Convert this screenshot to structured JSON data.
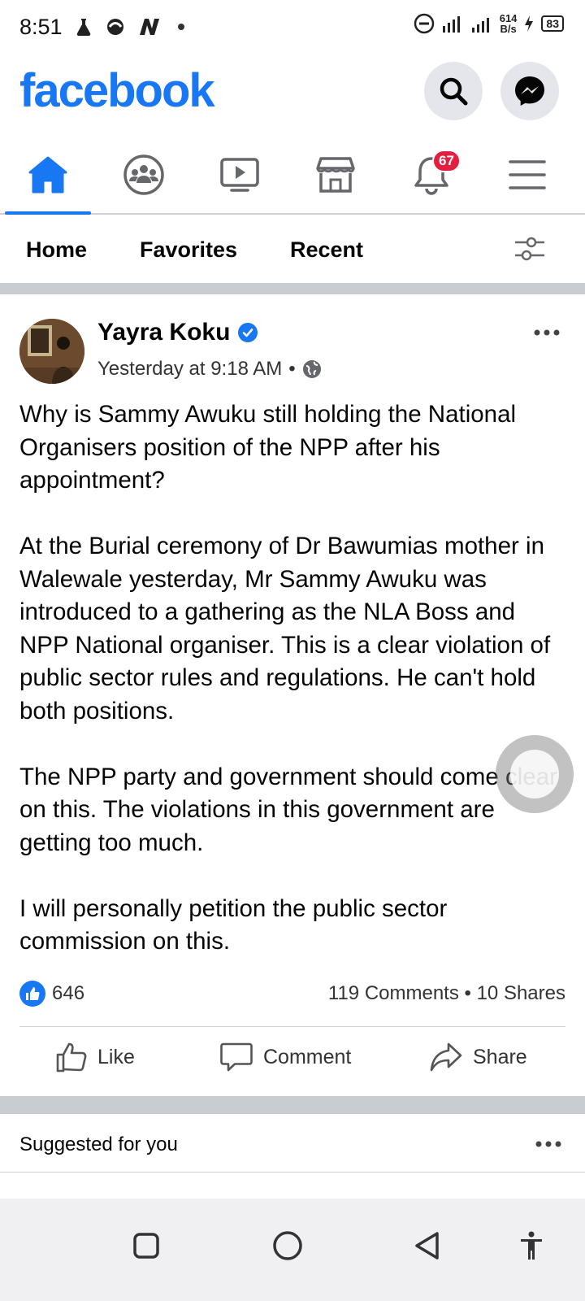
{
  "status_bar": {
    "time": "8:51",
    "net_speed_value": "614",
    "net_speed_unit": "B/s",
    "battery": "83"
  },
  "header": {
    "logo": "facebook",
    "search_icon": "search-icon",
    "messenger_icon": "messenger-icon"
  },
  "nav": {
    "items": [
      {
        "icon": "home-icon",
        "active": true
      },
      {
        "icon": "groups-icon"
      },
      {
        "icon": "video-icon"
      },
      {
        "icon": "marketplace-icon"
      },
      {
        "icon": "notifications-icon",
        "badge": "67"
      },
      {
        "icon": "menu-icon"
      }
    ],
    "accent": "#1877f2",
    "badge_color": "#e41e3f"
  },
  "feed_tabs": {
    "home": "Home",
    "favorites": "Favorites",
    "recent": "Recent",
    "filter_icon": "filter-sliders-icon"
  },
  "post": {
    "author": "Yayra Koku",
    "timestamp": "Yesterday at 9:18 AM",
    "separator": "•",
    "privacy_icon": "globe-icon",
    "paragraphs": [
      "Why is Sammy Awuku still holding the National Organisers position of the NPP after his appointment?",
      "At the Burial ceremony of Dr Bawumias mother in Walewale yesterday, Mr Sammy Awuku was introduced to a gathering as the NLA Boss and NPP National organiser. This is a clear violation of public sector rules and regulations. He can't hold both positions.",
      "The NPP party and government should come clear on this. The violations in this government are getting too much.",
      "I will personally petition the public sector commission on this."
    ],
    "likes": "646",
    "comments_shares": "119 Comments • 10 Shares",
    "actions": {
      "like": "Like",
      "comment": "Comment",
      "share": "Share"
    }
  },
  "suggested": {
    "label": "Suggested for you"
  }
}
